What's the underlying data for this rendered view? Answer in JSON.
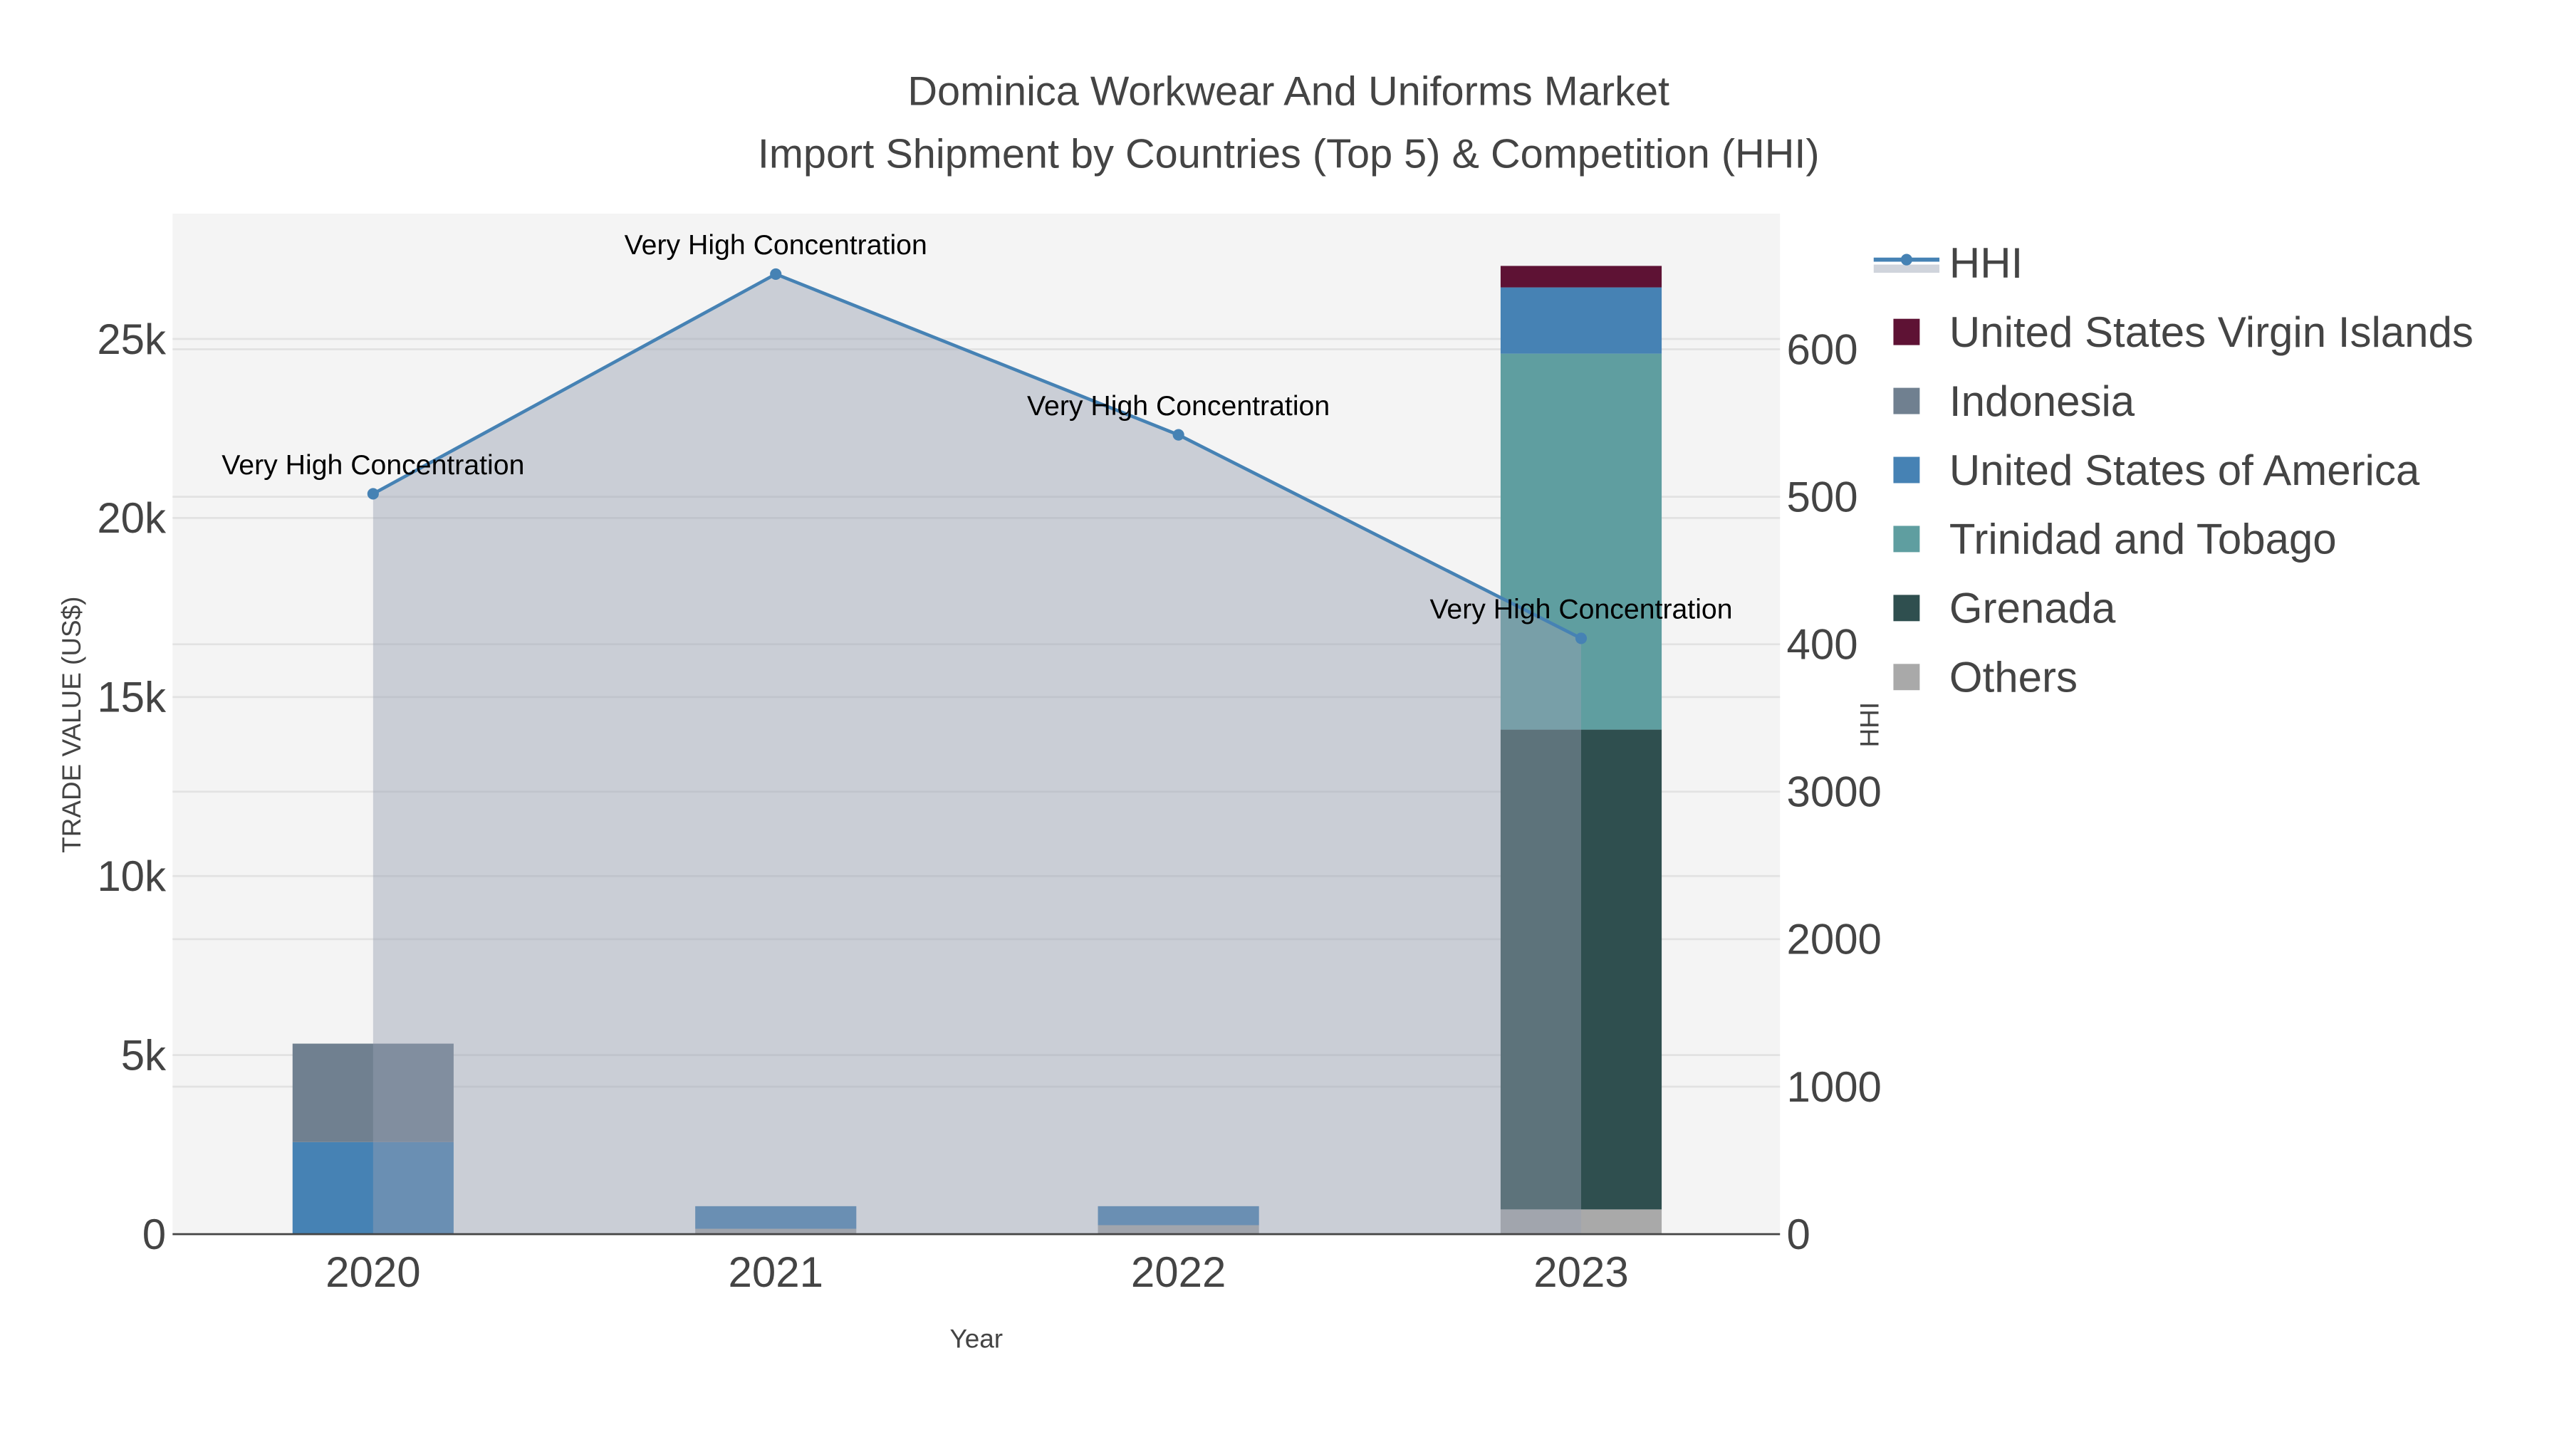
{
  "chart_data": {
    "type": "bar",
    "title": "Dominica Workwear And Uniforms Market",
    "subtitle": "Import Shipment by Countries (Top 5) & Competition (HHI)",
    "xlabel": "Year",
    "ylabel": "TRADE VALUE (US$)",
    "y2label": "HHI",
    "categories": [
      "2020",
      "2021",
      "2022",
      "2023"
    ],
    "ylim": [
      0,
      28500
    ],
    "y_ticks": [
      {
        "value": 0,
        "label": "0"
      },
      {
        "value": 5000,
        "label": "5k"
      },
      {
        "value": 10000,
        "label": "10k"
      },
      {
        "value": 15000,
        "label": "15k"
      },
      {
        "value": 20000,
        "label": "20k"
      },
      {
        "value": 25000,
        "label": "25k"
      }
    ],
    "y2lim": [
      0,
      692
    ],
    "y2_ticks": [
      {
        "value": 0,
        "label": "0"
      },
      {
        "value": 100,
        "label": "1000"
      },
      {
        "value": 200,
        "label": "2000"
      },
      {
        "value": 300,
        "label": "3000"
      },
      {
        "value": 400,
        "label": "400"
      },
      {
        "value": 500,
        "label": "500"
      },
      {
        "value": 600,
        "label": "600"
      }
    ],
    "stack_order": [
      "Others",
      "Grenada",
      "Trinidad and Tobago",
      "United States of America",
      "Indonesia",
      "United States Virgin Islands"
    ],
    "series": [
      {
        "name": "United States Virgin Islands",
        "color": "#5e1234",
        "values": [
          0,
          0,
          0,
          600
        ]
      },
      {
        "name": "Indonesia",
        "color": "#708090",
        "values": [
          2750,
          0,
          0,
          0
        ]
      },
      {
        "name": "United States of America",
        "color": "#4682b4",
        "values": [
          2570,
          630,
          530,
          1850
        ]
      },
      {
        "name": "Trinidad and Tobago",
        "color": "#5f9ea0",
        "values": [
          0,
          0,
          0,
          10500
        ]
      },
      {
        "name": "Grenada",
        "color": "#2f4f4f",
        "values": [
          0,
          0,
          0,
          13400
        ]
      },
      {
        "name": "Others",
        "color": "#a9a9a9",
        "values": [
          0,
          150,
          250,
          690
        ]
      }
    ],
    "hhi": {
      "name": "HHI",
      "color": "#4682b4",
      "values": [
        502,
        651,
        542,
        404
      ],
      "annotations": [
        "Very High Concentration",
        "Very High Concentration",
        "Very High Concentration",
        "Very High Concentration"
      ]
    },
    "legend": [
      "HHI",
      "United States Virgin Islands",
      "Indonesia",
      "United States of America",
      "Trinidad and Tobago",
      "Grenada",
      "Others"
    ],
    "legend_position": "right",
    "grid": true
  }
}
